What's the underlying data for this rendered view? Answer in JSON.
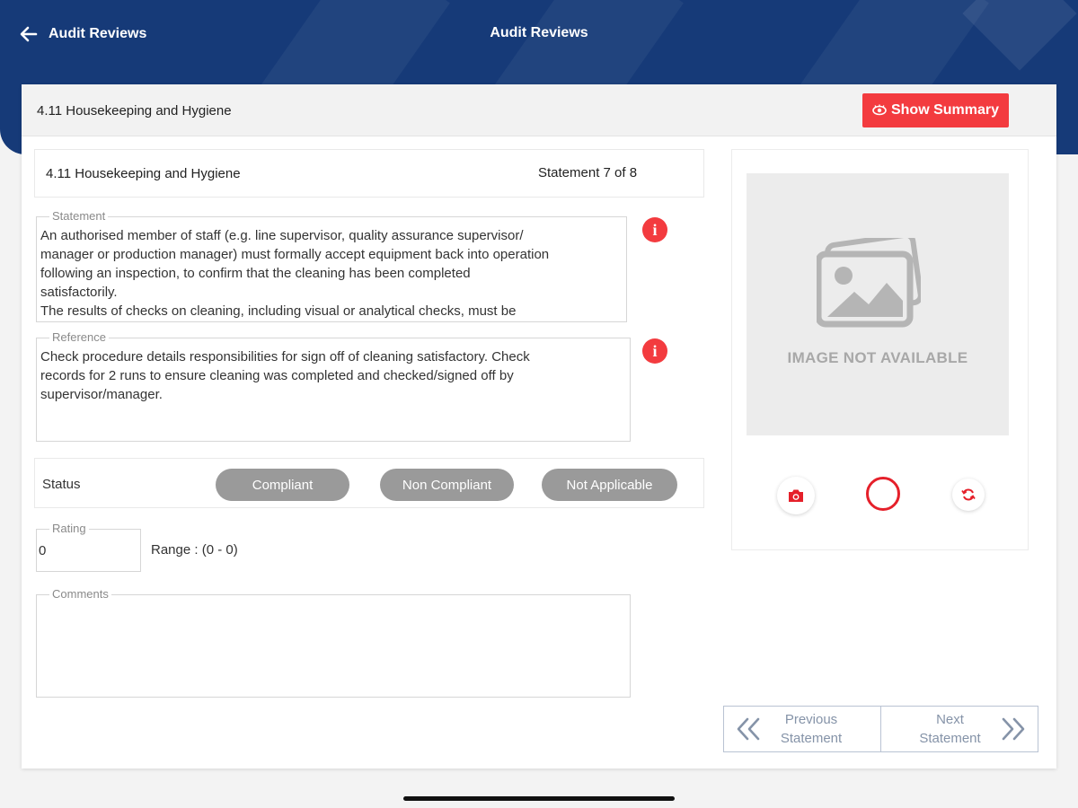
{
  "header": {
    "back_label": "Audit Reviews",
    "title": "Audit Reviews"
  },
  "card": {
    "section_title": "4.11 Housekeeping and Hygiene",
    "summary_button": "Show Summary"
  },
  "statement_header": {
    "title": "4.11 Housekeeping and Hygiene",
    "counter": "Statement 7 of 8"
  },
  "statement": {
    "label": "Statement",
    "text": "An authorised member of staff (e.g. line supervisor, quality assurance supervisor/\nmanager or production manager) must formally accept equipment back into operation\nfollowing an inspection, to confirm that the cleaning has been completed\nsatisfactorily.\nThe results of checks on cleaning, including visual or analytical checks, must be"
  },
  "reference": {
    "label": "Reference",
    "text": "Check procedure details responsibilities for sign off of cleaning satisfactory. Check\nrecords for 2 runs to ensure cleaning was completed and checked/signed off by\nsupervisor/manager."
  },
  "status": {
    "label": "Status",
    "options": [
      "Compliant",
      "Non Compliant",
      "Not Applicable"
    ]
  },
  "rating": {
    "label": "Rating",
    "value": "0",
    "range": "Range : (0 - 0)"
  },
  "comments": {
    "label": "Comments",
    "value": ""
  },
  "media": {
    "placeholder_text": "IMAGE NOT AVAILABLE"
  },
  "navigation": {
    "previous_line1": "Previous",
    "previous_line2": "Statement",
    "next_line1": "Next",
    "next_line2": "Statement"
  },
  "colors": {
    "header_bg": "#163a78",
    "accent_red": "#f33b3f",
    "pill_gray": "#9a9a9a",
    "nav_text": "#8593a8"
  }
}
